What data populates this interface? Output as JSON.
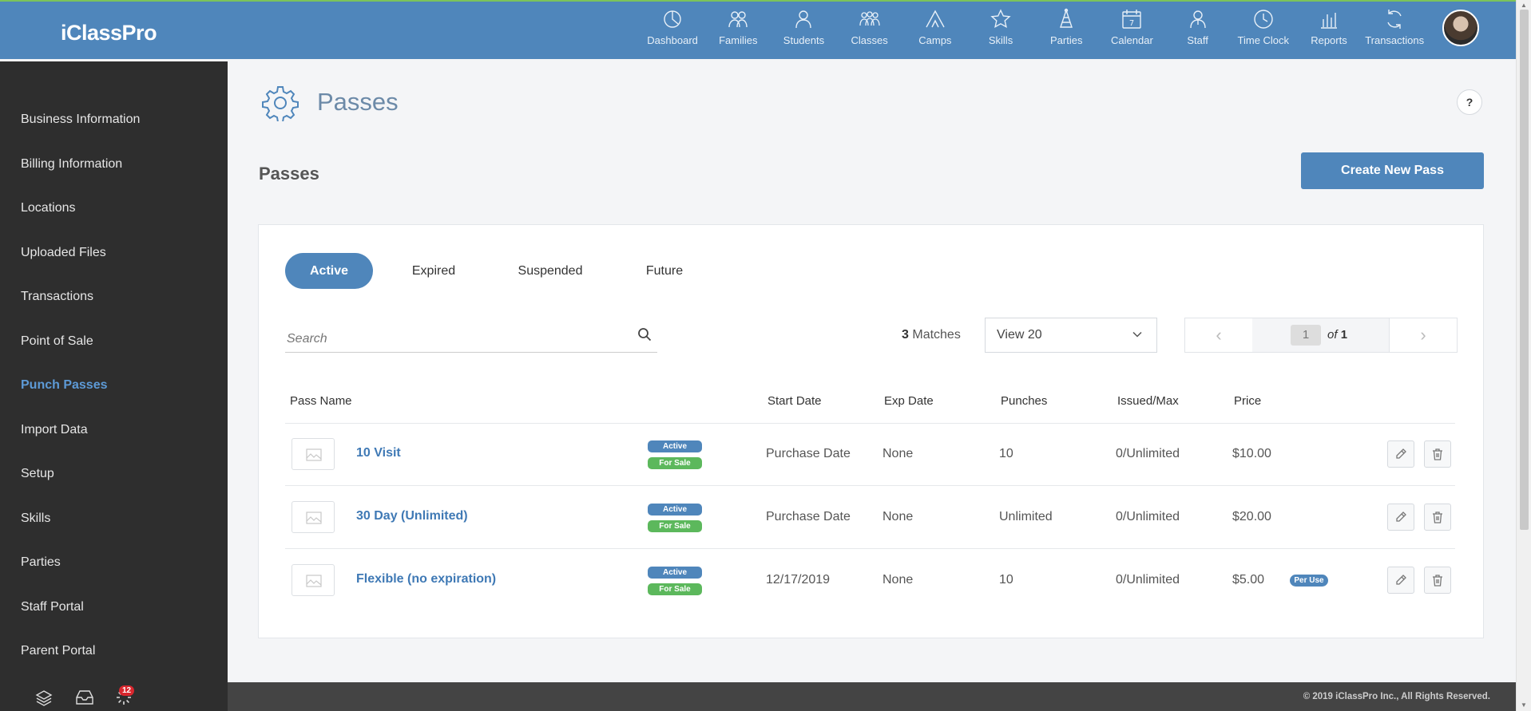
{
  "app": {
    "logo": "iClassPro"
  },
  "topnav": [
    {
      "label": "Dashboard",
      "icon": "dashboard-icon"
    },
    {
      "label": "Families",
      "icon": "families-icon"
    },
    {
      "label": "Students",
      "icon": "students-icon"
    },
    {
      "label": "Classes",
      "icon": "classes-icon"
    },
    {
      "label": "Camps",
      "icon": "camps-icon"
    },
    {
      "label": "Skills",
      "icon": "skills-icon"
    },
    {
      "label": "Parties",
      "icon": "parties-icon"
    },
    {
      "label": "Calendar",
      "icon": "calendar-icon"
    },
    {
      "label": "Staff",
      "icon": "staff-icon"
    },
    {
      "label": "Time Clock",
      "icon": "clock-icon"
    },
    {
      "label": "Reports",
      "icon": "reports-icon"
    },
    {
      "label": "Transactions",
      "icon": "transactions-icon"
    }
  ],
  "calendar_day": "7",
  "sidebar": {
    "items": [
      {
        "label": "Business Information"
      },
      {
        "label": "Billing Information"
      },
      {
        "label": "Locations"
      },
      {
        "label": "Uploaded Files"
      },
      {
        "label": "Transactions"
      },
      {
        "label": "Point of Sale"
      },
      {
        "label": "Punch Passes",
        "active": true
      },
      {
        "label": "Import Data"
      },
      {
        "label": "Setup"
      },
      {
        "label": "Skills"
      },
      {
        "label": "Parties"
      },
      {
        "label": "Staff Portal"
      },
      {
        "label": "Parent Portal"
      }
    ],
    "notification_count": "12"
  },
  "page": {
    "title": "Passes",
    "help_label": "?",
    "section_title": "Passes",
    "create_button": "Create New Pass"
  },
  "tabs": [
    {
      "label": "Active",
      "selected": true
    },
    {
      "label": "Expired"
    },
    {
      "label": "Suspended"
    },
    {
      "label": "Future"
    }
  ],
  "search": {
    "placeholder": "Search",
    "value": ""
  },
  "results": {
    "count": "3",
    "label": "Matches"
  },
  "view": {
    "selected": "View 20"
  },
  "pagination": {
    "current": "1",
    "of_label": "of",
    "total": "1",
    "prev": "‹",
    "next": "›"
  },
  "table": {
    "columns": [
      "Pass Name",
      "Start Date",
      "Exp Date",
      "Punches",
      "Issued/Max",
      "Price"
    ],
    "rows": [
      {
        "name": "10 Visit",
        "status": "Active",
        "sale": "For Sale",
        "start": "Purchase Date",
        "exp": "None",
        "punches": "10",
        "issued": "0/Unlimited",
        "price": "$10.00",
        "tag": ""
      },
      {
        "name": "30 Day (Unlimited)",
        "status": "Active",
        "sale": "For Sale",
        "start": "Purchase Date",
        "exp": "None",
        "punches": "Unlimited",
        "issued": "0/Unlimited",
        "price": "$20.00",
        "tag": ""
      },
      {
        "name": "Flexible (no expiration)",
        "status": "Active",
        "sale": "For Sale",
        "start": "12/17/2019",
        "exp": "None",
        "punches": "10",
        "issued": "0/Unlimited",
        "price": "$5.00",
        "tag": "Per Use"
      }
    ]
  },
  "footer": {
    "copyright": "© 2019 iClassPro Inc., All Rights Reserved."
  },
  "colors": {
    "brand": "#4f86bb",
    "sidebar": "#2e2e2e",
    "active_link": "#5d9ad6",
    "for_sale": "#5cb85c"
  }
}
